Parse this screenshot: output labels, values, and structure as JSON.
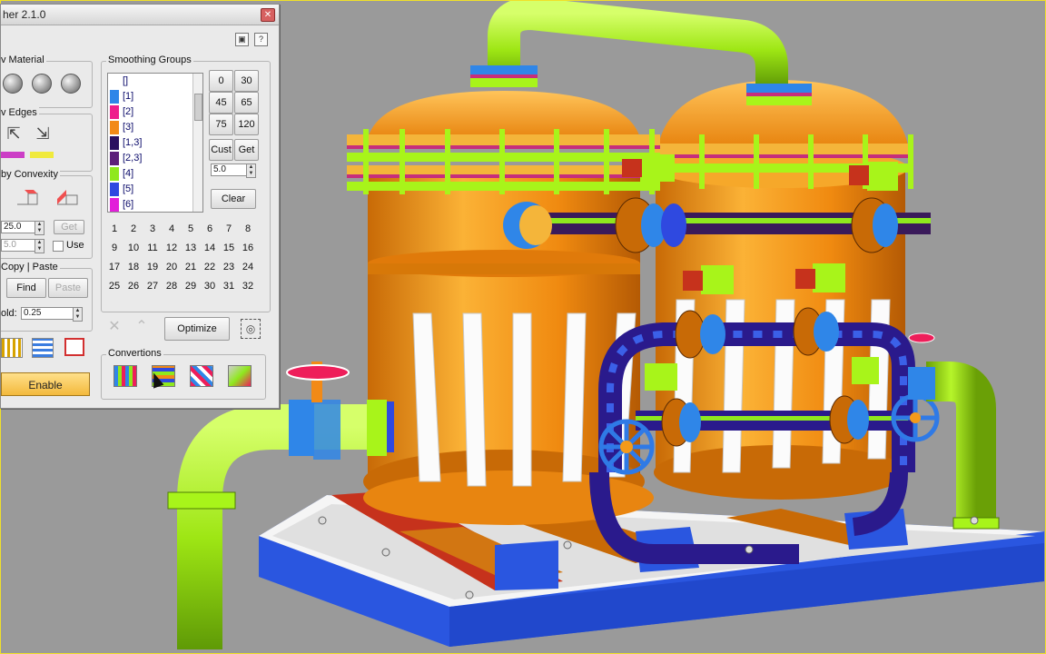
{
  "window_title": "her 2.1.0",
  "toolbar_icons": [
    "pin-icon",
    "help-icon"
  ],
  "sections": {
    "material": {
      "label": "v Material"
    },
    "edges": {
      "label": "v Edges",
      "swatch_colors": [
        "#cc3ec6",
        "#f0ea3c"
      ]
    },
    "convexity": {
      "label": "by Convexity",
      "field1_value": "25.0",
      "get_label": "Get",
      "field2_value": "5.0",
      "use_label": "Use"
    },
    "copy_paste": {
      "label": "Copy | Paste",
      "find_label": "Find",
      "paste_label": "Paste",
      "threshold_label": "old:",
      "threshold_value": "0.25"
    },
    "enable_label": "Enable"
  },
  "smoothing_groups": {
    "label": "Smoothing Groups",
    "list": [
      {
        "text": "[]",
        "color": "#ffffff"
      },
      {
        "text": "[1]",
        "color": "#2f86e8"
      },
      {
        "text": "[2]",
        "color": "#ee1e8c"
      },
      {
        "text": "[3]",
        "color": "#f28a17"
      },
      {
        "text": "[1,3]",
        "color": "#2a1060"
      },
      {
        "text": "[2,3]",
        "color": "#5d1f7a"
      },
      {
        "text": "[4]",
        "color": "#8fe81e"
      },
      {
        "text": "[5]",
        "color": "#2f49e0"
      },
      {
        "text": "[6]",
        "color": "#e21fd9"
      }
    ],
    "angle_buttons": [
      "0",
      "30",
      "45",
      "65",
      "75",
      "120"
    ],
    "cust_label": "Cust",
    "get_label": "Get",
    "threshold_value": "5.0",
    "clear_label": "Clear",
    "numbers": [
      "1",
      "2",
      "3",
      "4",
      "5",
      "6",
      "7",
      "8",
      "9",
      "10",
      "11",
      "12",
      "13",
      "14",
      "15",
      "16",
      "17",
      "18",
      "19",
      "20",
      "21",
      "22",
      "23",
      "24",
      "25",
      "26",
      "27",
      "28",
      "29",
      "30",
      "31",
      "32"
    ],
    "optimize_label": "Optimize"
  },
  "convertions": {
    "label": "Convertions",
    "icons": [
      "convert-to-material-icon",
      "convert-to-smoothing-icon",
      "convert-to-id-icon",
      "convert-to-element-icon"
    ]
  },
  "scene": {
    "name": "3D viewport - filter tanks",
    "colors": {
      "background": "#9a9a9a",
      "tank": "#f59a1a",
      "pipe_green": "#a8f41a",
      "pipe_blue": "#2a1a8c",
      "flange_blue": "#2f86e8",
      "base": "#2a56e0",
      "skid_red": "#c6321c",
      "wheel": "#2f7ae6"
    }
  }
}
